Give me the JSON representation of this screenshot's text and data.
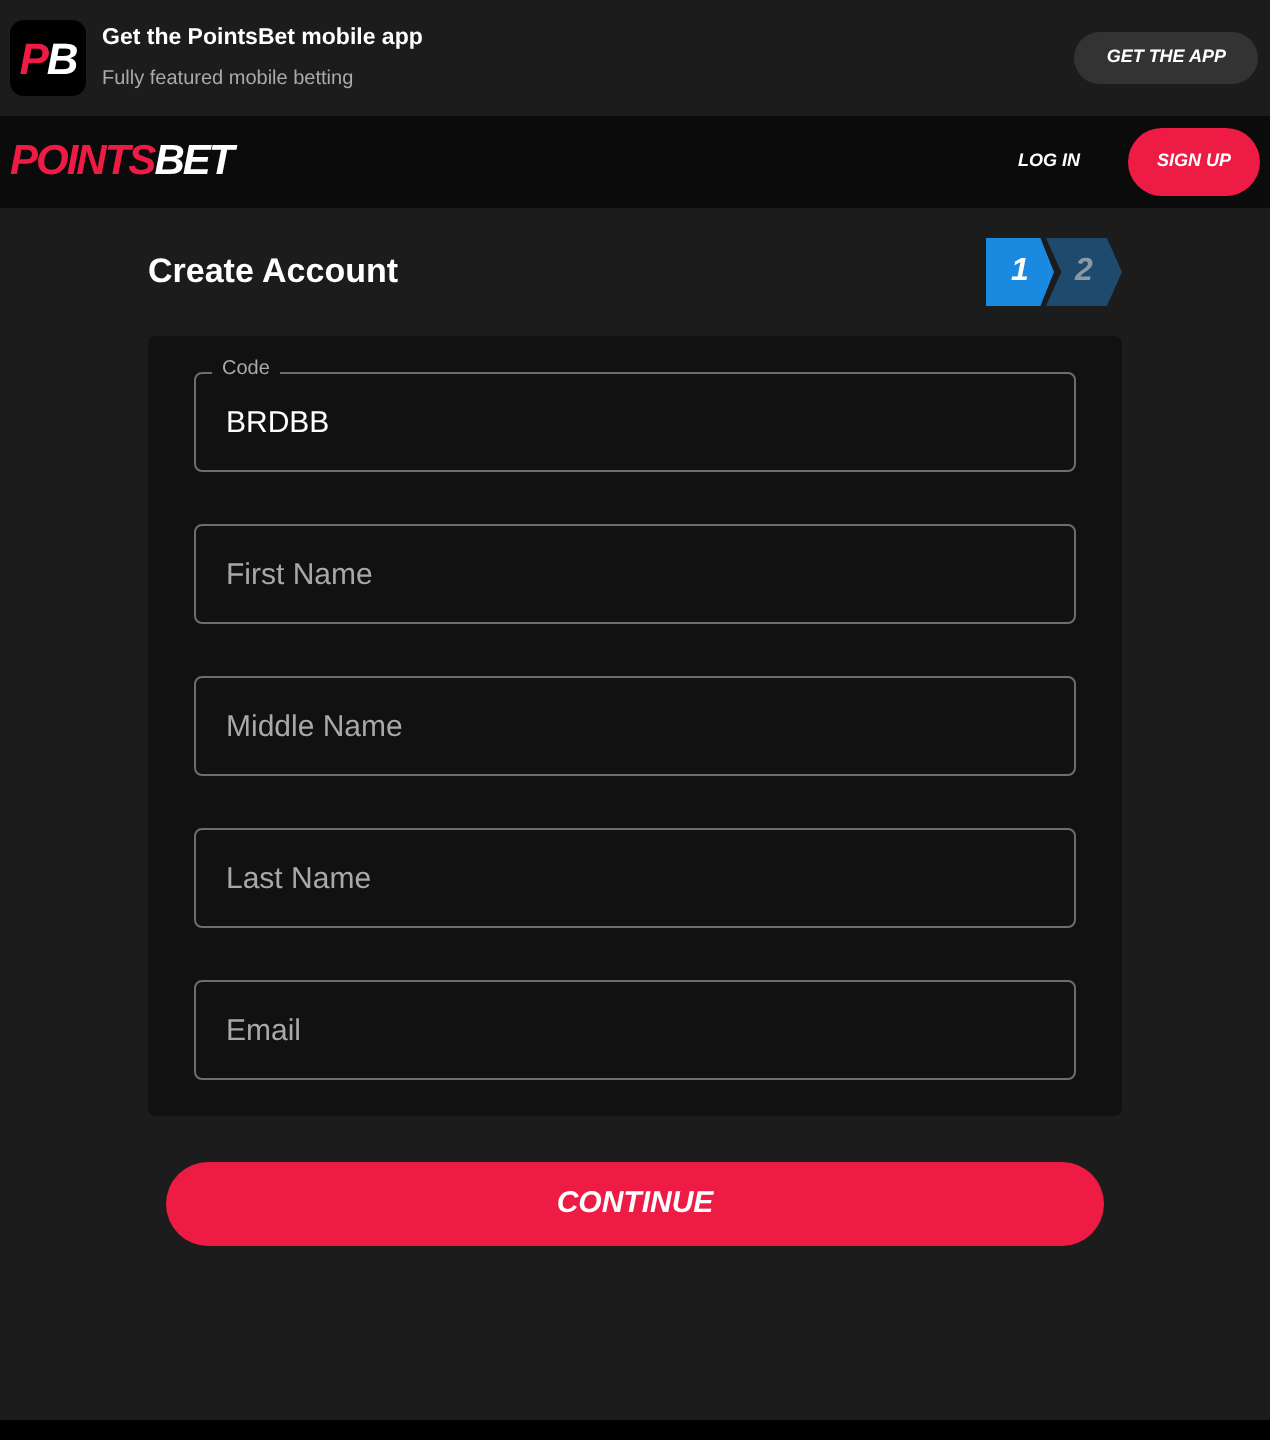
{
  "app_banner": {
    "icon_letters": [
      {
        "text": "P",
        "kind": "accent"
      },
      {
        "text": "B",
        "kind": "plain"
      }
    ],
    "title": "Get the PointsBet mobile app",
    "subtitle": "Fully featured mobile betting",
    "button": "GET THE APP"
  },
  "navbar": {
    "logo": [
      {
        "text": "POINTS",
        "kind": "accent"
      },
      {
        "text": "BET",
        "kind": "plain"
      }
    ],
    "login": "LOG IN",
    "signup": "SIGN UP"
  },
  "form": {
    "title": "Create Account",
    "steps": [
      {
        "label": "1",
        "selected": true
      },
      {
        "label": "2",
        "selected": false
      }
    ],
    "fields": [
      {
        "label": "Code",
        "value": "BRDBB"
      },
      {
        "placeholder": "First Name"
      },
      {
        "placeholder": "Middle Name"
      },
      {
        "placeholder": "Last Name"
      },
      {
        "placeholder": "Email"
      }
    ],
    "button": "CONTINUE"
  }
}
